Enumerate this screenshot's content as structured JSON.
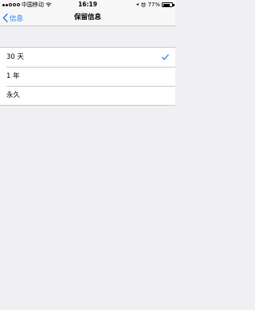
{
  "status_bar": {
    "carrier": "中国移动",
    "time": "16:19",
    "battery_text": "77%",
    "battery_level": 0.77
  },
  "nav": {
    "back_label": "信息",
    "title": "保留信息"
  },
  "options": [
    {
      "label": "30 天",
      "selected": true
    },
    {
      "label": "1 年",
      "selected": false
    },
    {
      "label": "永久",
      "selected": false
    }
  ],
  "colors": {
    "accent": "#1a7cf5",
    "background": "#efeff4"
  }
}
